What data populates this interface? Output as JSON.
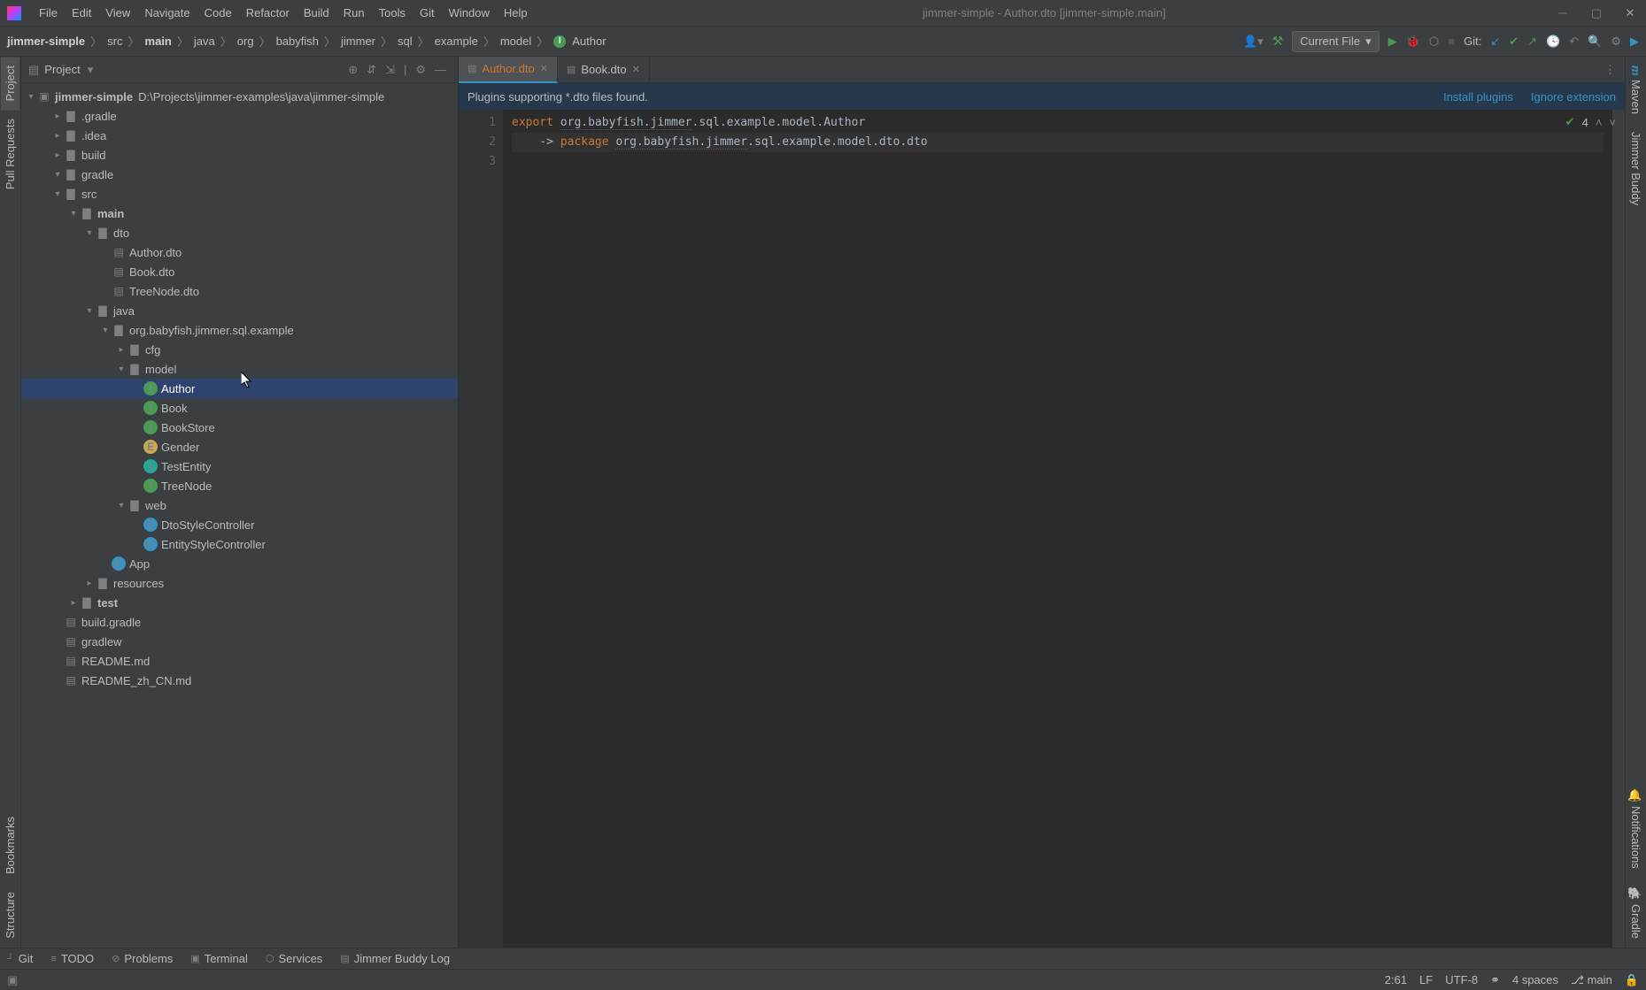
{
  "window": {
    "title": "jimmer-simple - Author.dto [jimmer-simple.main]"
  },
  "menu": [
    "File",
    "Edit",
    "View",
    "Navigate",
    "Code",
    "Refactor",
    "Build",
    "Run",
    "Tools",
    "Git",
    "Window",
    "Help"
  ],
  "breadcrumb": [
    "jimmer-simple",
    "src",
    "main",
    "java",
    "org",
    "babyfish",
    "jimmer",
    "sql",
    "example",
    "model",
    "Author"
  ],
  "run_config": "Current File",
  "vcs_label": "Git:",
  "left_tabs": [
    "Project",
    "Pull Requests",
    "Bookmarks",
    "Structure"
  ],
  "right_tabs": [
    "Maven",
    "Jimmer Buddy",
    "Notifications",
    "Gradle"
  ],
  "project_panel": {
    "title": "Project"
  },
  "tree": {
    "root": "jimmer-simple",
    "root_path": "D:\\Projects\\jimmer-examples\\java\\jimmer-simple",
    "nodes": [
      {
        "d": 1,
        "chev": "right",
        "icon": "folder-o",
        "label": ".gradle",
        "color": "c-yellow"
      },
      {
        "d": 1,
        "chev": "right",
        "icon": "folder-g",
        "label": ".idea",
        "color": "c-yellow"
      },
      {
        "d": 1,
        "chev": "right",
        "icon": "folder-o",
        "label": "build",
        "color": "c-yellow"
      },
      {
        "d": 1,
        "chev": "down",
        "icon": "folder-g",
        "label": "gradle",
        "color": ""
      },
      {
        "d": 1,
        "chev": "down",
        "icon": "folder-g",
        "label": "src",
        "color": ""
      },
      {
        "d": 2,
        "chev": "down",
        "icon": "folder-g",
        "label": "main",
        "color": "c-bold"
      },
      {
        "d": 3,
        "chev": "down",
        "icon": "folder-g",
        "label": "dto",
        "color": ""
      },
      {
        "d": 4,
        "chev": "none",
        "icon": "file-g",
        "label": "Author.dto",
        "color": "c-red"
      },
      {
        "d": 4,
        "chev": "none",
        "icon": "file-g",
        "label": "Book.dto",
        "color": ""
      },
      {
        "d": 4,
        "chev": "none",
        "icon": "file-g",
        "label": "TreeNode.dto",
        "color": ""
      },
      {
        "d": 3,
        "chev": "down",
        "icon": "folder-g",
        "label": "java",
        "color": ""
      },
      {
        "d": 4,
        "chev": "down",
        "icon": "folder-g",
        "label": "org.babyfish.jimmer.sql.example",
        "color": ""
      },
      {
        "d": 5,
        "chev": "right",
        "icon": "folder-g",
        "label": "cfg",
        "color": ""
      },
      {
        "d": 5,
        "chev": "down",
        "icon": "folder-g",
        "label": "model",
        "color": ""
      },
      {
        "d": 6,
        "chev": "none",
        "icon": "iface",
        "label": "Author",
        "color": "",
        "selected": true
      },
      {
        "d": 6,
        "chev": "none",
        "icon": "iface",
        "label": "Book",
        "color": ""
      },
      {
        "d": 6,
        "chev": "none",
        "icon": "iface",
        "label": "BookStore",
        "color": "c-teal"
      },
      {
        "d": 6,
        "chev": "none",
        "icon": "enum",
        "label": "Gender",
        "color": ""
      },
      {
        "d": 6,
        "chev": "none",
        "icon": "iface-t",
        "label": "TestEntity",
        "color": "c-teal"
      },
      {
        "d": 6,
        "chev": "none",
        "icon": "iface",
        "label": "TreeNode",
        "color": ""
      },
      {
        "d": 5,
        "chev": "down",
        "icon": "folder-g",
        "label": "web",
        "color": ""
      },
      {
        "d": 6,
        "chev": "none",
        "icon": "class",
        "label": "DtoStyleController",
        "color": ""
      },
      {
        "d": 6,
        "chev": "none",
        "icon": "class",
        "label": "EntityStyleController",
        "color": ""
      },
      {
        "d": 4,
        "chev": "none",
        "icon": "class",
        "label": "App",
        "color": ""
      },
      {
        "d": 3,
        "chev": "right",
        "icon": "folder-g",
        "label": "resources",
        "color": ""
      },
      {
        "d": 2,
        "chev": "right",
        "icon": "folder-g",
        "label": "test",
        "color": "c-bold"
      },
      {
        "d": 1,
        "chev": "none",
        "icon": "file-g",
        "label": "build.gradle",
        "color": "c-blue"
      },
      {
        "d": 1,
        "chev": "none",
        "icon": "file-g",
        "label": "gradlew",
        "color": ""
      },
      {
        "d": 1,
        "chev": "none",
        "icon": "file-g",
        "label": "README.md",
        "color": ""
      },
      {
        "d": 1,
        "chev": "none",
        "icon": "file-g",
        "label": "README_zh_CN.md",
        "color": ""
      }
    ]
  },
  "editor": {
    "tabs": [
      {
        "label": "Author.dto",
        "active": true
      },
      {
        "label": "Book.dto",
        "active": false
      }
    ],
    "banner_text": "Plugins supporting *.dto files found.",
    "banner_install": "Install plugins",
    "banner_ignore": "Ignore extension",
    "code": {
      "lines": [
        "1",
        "2",
        "3"
      ],
      "l1_kw": "export",
      "l1_pkg": "org.babyfish.jimmer",
      "l1_rest": ".sql.example.model.Author",
      "l2_arrow": "->",
      "l2_kw": "package",
      "l2_pkg": "org.babyfish.jimmer",
      "l2_rest": ".sql.example.model.dto.dto"
    },
    "inspections": "4"
  },
  "bottom_tabs": [
    "Git",
    "TODO",
    "Problems",
    "Terminal",
    "Services",
    "Jimmer Buddy Log"
  ],
  "status": {
    "pos": "2:61",
    "lf": "LF",
    "enc": "UTF-8",
    "indent": "4 spaces",
    "branch": "main"
  }
}
